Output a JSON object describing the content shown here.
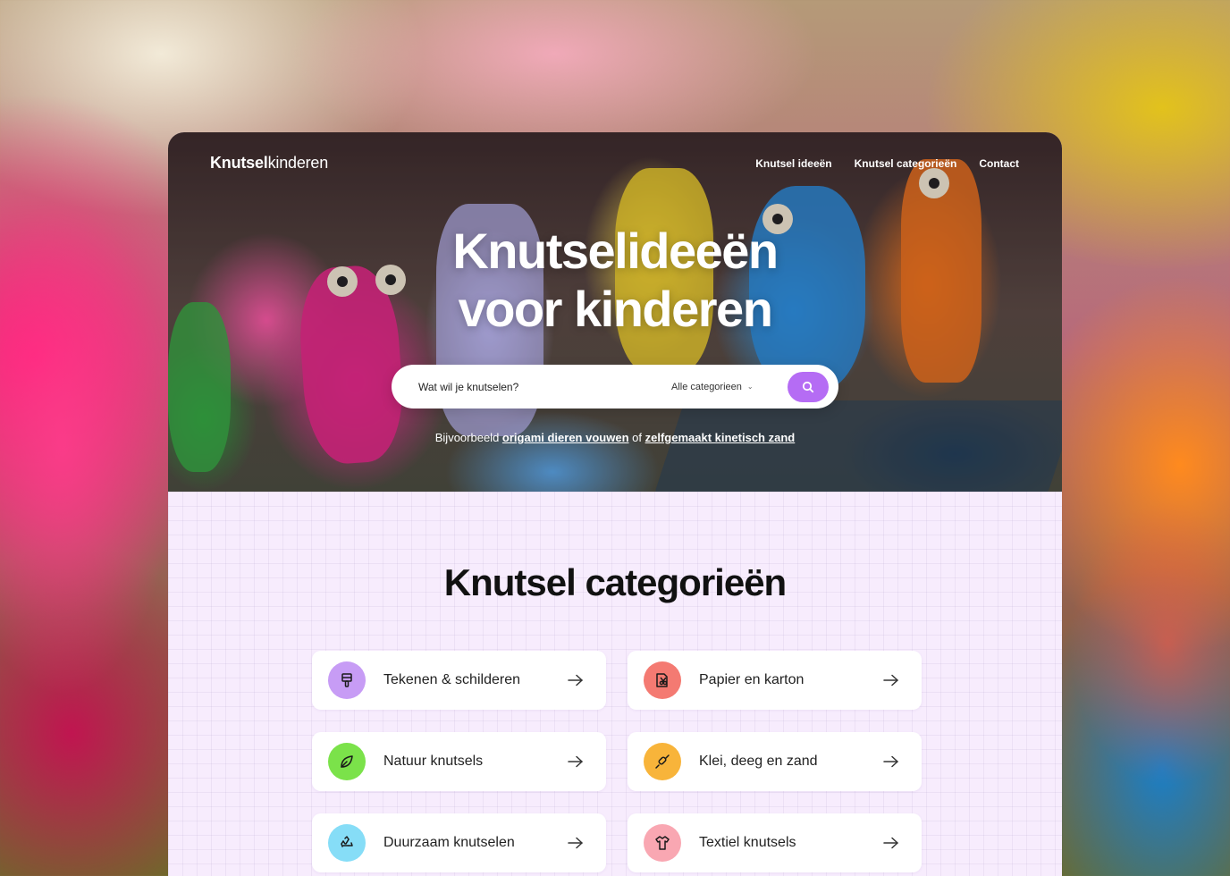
{
  "header": {
    "logo_bold": "Knutsel",
    "logo_light": "kinderen",
    "nav": [
      {
        "label": "Knutsel ideeën"
      },
      {
        "label": "Knutsel categorieën"
      },
      {
        "label": "Contact"
      }
    ]
  },
  "hero": {
    "title_line1": "Knutselideeën",
    "title_line2": "voor kinderen",
    "search_placeholder": "Wat wil je knutselen?",
    "category_select": "Alle categorieen",
    "hint_prefix": "Bijvoorbeeld",
    "hint_link1": "origami dieren vouwen",
    "hint_middle": "of",
    "hint_link2": "zelfgemaakt kinetisch zand"
  },
  "categories": {
    "title": "Knutsel categorieën",
    "items": [
      {
        "label": "Tekenen & schilderen",
        "icon": "paint-brush-icon",
        "color": "#c79cf5"
      },
      {
        "label": "Papier en karton",
        "icon": "paper-scissors-icon",
        "color": "#f47a72"
      },
      {
        "label": "Natuur knutsels",
        "icon": "leaf-icon",
        "color": "#7be24a"
      },
      {
        "label": "Klei, deeg en zand",
        "icon": "rolling-pin-icon",
        "color": "#f8b43a"
      },
      {
        "label": "Duurzaam knutselen",
        "icon": "recycle-icon",
        "color": "#86ddf7"
      },
      {
        "label": "Textiel knutsels",
        "icon": "tshirt-icon",
        "color": "#f9a7b2"
      }
    ]
  },
  "colors": {
    "accent": "#b56cf4",
    "section_bg": "#f7ecfd"
  }
}
